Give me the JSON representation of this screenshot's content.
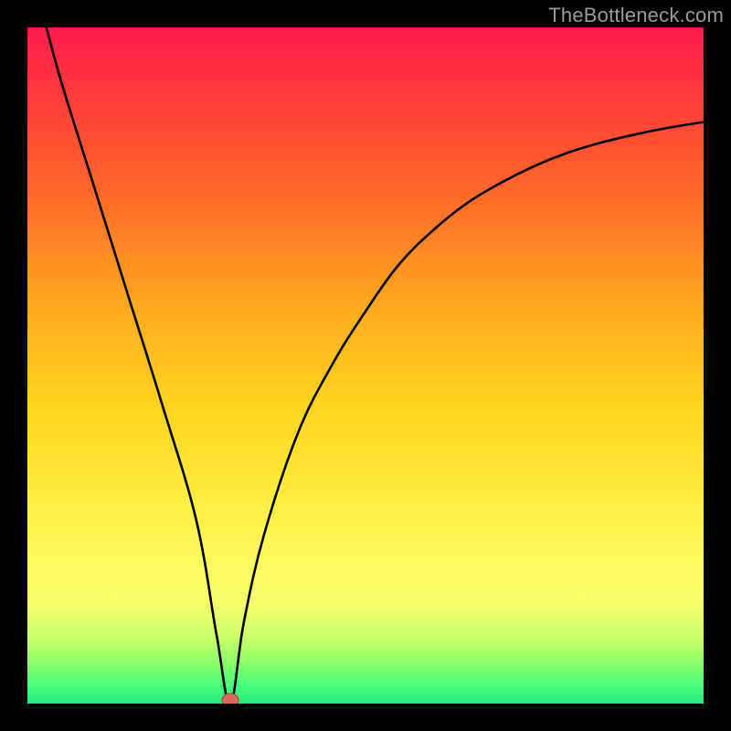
{
  "attribution": "TheBottleneck.com",
  "chart_data": {
    "type": "line",
    "title": "",
    "xlabel": "",
    "ylabel": "",
    "xlim": [
      0,
      100
    ],
    "ylim": [
      0,
      100
    ],
    "minimum_x": 30,
    "marker": {
      "x": 30,
      "y": 0,
      "color": "#d46a5a"
    },
    "series": [
      {
        "name": "bottleneck-curve",
        "x": [
          0,
          2,
          5,
          10,
          15,
          20,
          25,
          28,
          30,
          32,
          35,
          40,
          45,
          50,
          55,
          60,
          65,
          70,
          75,
          80,
          85,
          90,
          95,
          100
        ],
        "values": [
          110,
          103,
          92,
          76,
          60,
          44,
          27,
          10,
          0,
          12,
          25,
          40,
          50,
          58,
          65,
          70,
          74,
          77,
          79.5,
          81.5,
          83,
          84.2,
          85.2,
          86
        ]
      }
    ]
  }
}
